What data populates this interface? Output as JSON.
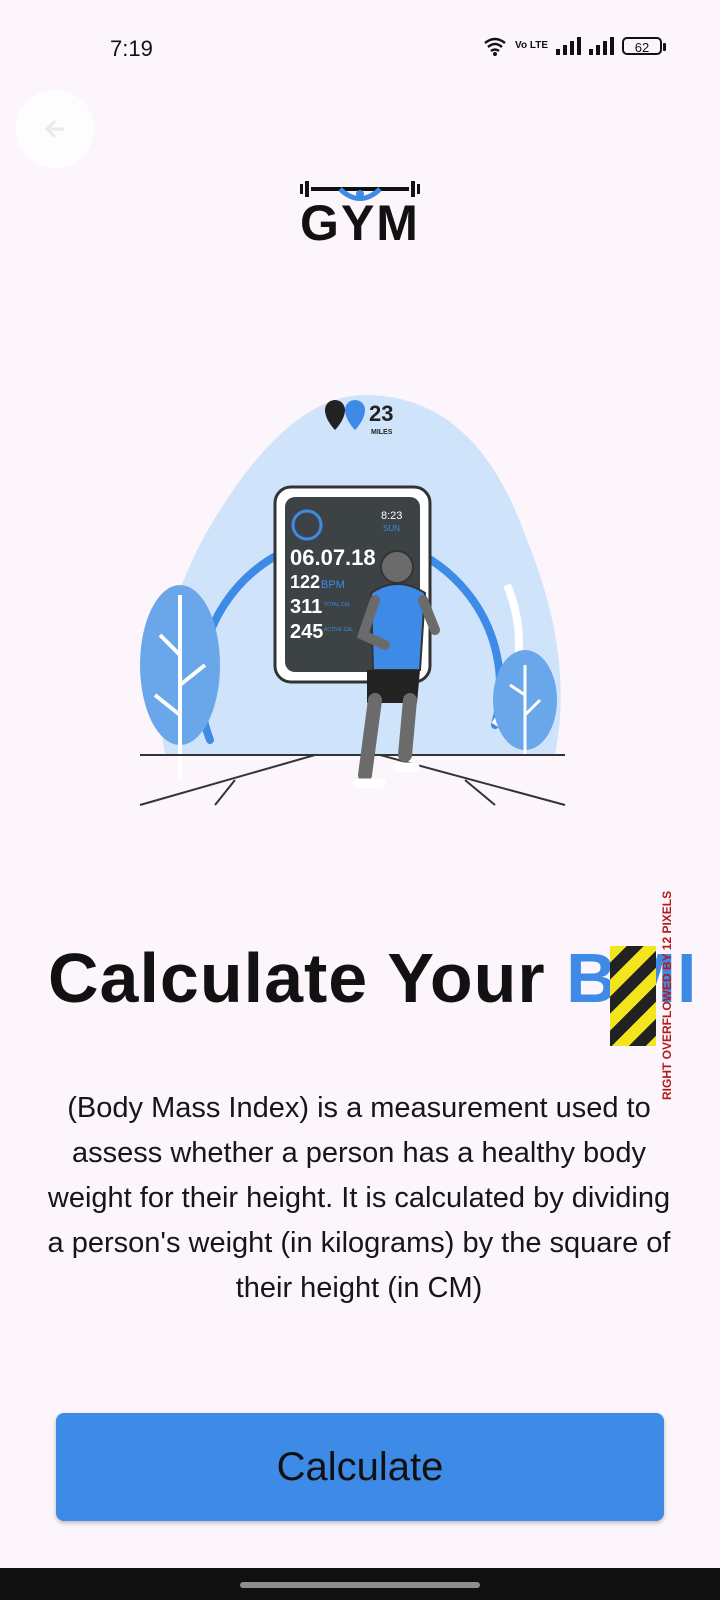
{
  "status_bar": {
    "time": "7:19",
    "volte": "Vo LTE",
    "battery": "62"
  },
  "logo": {
    "text": "GYM"
  },
  "illustration": {
    "miles_value": "23",
    "miles_label": "MILES",
    "watch_time": "8:23",
    "watch_day": "SUN",
    "watch_date": "06.07.18",
    "bpm_value": "122",
    "bpm_label": "BPM",
    "total_cal_value": "311",
    "total_cal_label": "TOTAL CAL",
    "active_cal_value": "245",
    "active_cal_label": "ACTIVE CAL"
  },
  "title": {
    "text": "Calculate Your ",
    "highlight": "BMI",
    "highlight_color": "#3d8be6"
  },
  "debug_overflow": "RIGHT OVERFLOWED BY 12 PIXELS",
  "description": "(Body Mass Index) is a measurement used to assess whether a person has a healthy body weight for their height. It is calculated by dividing a person's weight (in kilograms) by the square of their height (in CM)",
  "primary_button": {
    "label": "Calculate",
    "color": "#3d8be6"
  }
}
